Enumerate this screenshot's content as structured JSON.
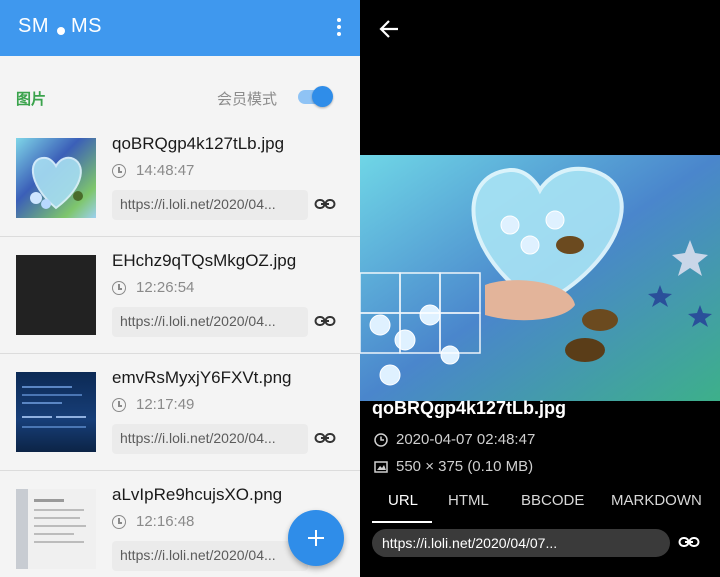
{
  "left": {
    "appbar": {
      "title_part1": "SM",
      "title_part2": "MS"
    },
    "section": {
      "label": "图片",
      "toggle_label": "会员模式",
      "toggle_on": true
    },
    "items": [
      {
        "name": "qoBRQgp4k127tLb.jpg",
        "time": "14:48:47",
        "url": "https://i.loli.net/2020/04...",
        "thumb": "flowers"
      },
      {
        "name": "EHchz9qTQsMkgOZ.jpg",
        "time": "12:26:54",
        "url": "https://i.loli.net/2020/04...",
        "thumb": "dark"
      },
      {
        "name": "emvRsMyxjY6FXVt.png",
        "time": "12:17:49",
        "url": "https://i.loli.net/2020/04...",
        "thumb": "blue"
      },
      {
        "name": "aLvIpRe9hcujsXO.png",
        "time": "12:16:48",
        "url": "https://i.loli.net/2020/04...",
        "thumb": "doc"
      }
    ]
  },
  "right": {
    "name": "qoBRQgp4k127tLb.jpg",
    "datetime": "2020-04-07 02:48:47",
    "dimensions": "550 × 375 (0.10 MB)",
    "tabs": [
      "URL",
      "HTML",
      "BBCODE",
      "MARKDOWN"
    ],
    "active_tab": "URL",
    "url": "https://i.loli.net/2020/04/07..."
  },
  "colors": {
    "primary": "#3f98ee",
    "accent": "#2f8de9",
    "section_green": "#3aa34c"
  },
  "icons": [
    "menu-icon",
    "clock-icon",
    "link-icon",
    "add-icon",
    "back-arrow-icon",
    "image-size-icon"
  ]
}
